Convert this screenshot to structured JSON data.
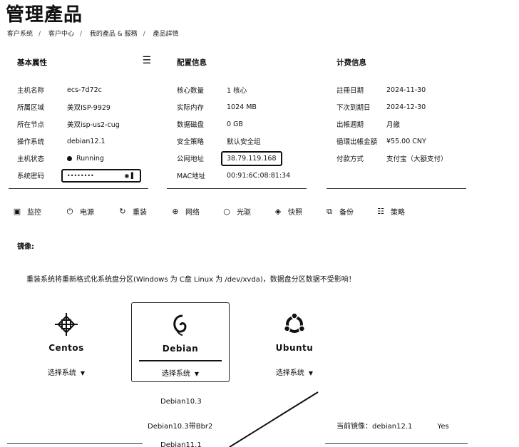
{
  "page": {
    "title": "管理產品"
  },
  "breadcrumb": [
    "客户系统",
    "客户中心",
    "我的產品 & 服務",
    "產品詳情"
  ],
  "basic": {
    "title": "基本属性",
    "rows": [
      {
        "label": "主机名称",
        "value": "ecs-7d72c"
      },
      {
        "label": "所属区域",
        "value": "美双ISP-9929"
      },
      {
        "label": "所在节点",
        "value": "美双isp-us2-cug"
      },
      {
        "label": "操作系统",
        "value": "debian12.1"
      },
      {
        "label": "主机状态",
        "value": "Running"
      },
      {
        "label": "系统密码",
        "value": "••••••••"
      }
    ]
  },
  "config": {
    "title": "配置信息",
    "rows": [
      {
        "label": "核心数量",
        "value": "1 核心"
      },
      {
        "label": "实际内存",
        "value": "1024 MB"
      },
      {
        "label": "数据磁盘",
        "value": "0 GB"
      },
      {
        "label": "安全策略",
        "value": "默认安全组"
      },
      {
        "label": "公网地址",
        "value": "38.79.119.168"
      },
      {
        "label": "MAC地址",
        "value": "00:91:6C:08:81:34"
      }
    ]
  },
  "billing": {
    "title": "计费信息",
    "rows": [
      {
        "label": "註冊日期",
        "value": "2024-11-30"
      },
      {
        "label": "下次到期日",
        "value": "2024-12-30"
      },
      {
        "label": "出帳週期",
        "value": "月繳"
      },
      {
        "label": "循環出帳金額",
        "value": "¥55.00 CNY"
      },
      {
        "label": "付款方式",
        "value": "支付宝（大额支付）"
      }
    ]
  },
  "toolbar": [
    "监控",
    "电源",
    "重装",
    "网络",
    "光驱",
    "快照",
    "备份",
    "策略"
  ],
  "mirror": {
    "label": "镜像:",
    "notice": "重装系统将重新格式化系统盘分区(Windows 为 C盘 Linux 为 /dev/xvda)，数据盘分区数据不受影响！"
  },
  "os_cards": [
    {
      "name": "Centos",
      "select": "选择系统"
    },
    {
      "name": "Debian",
      "select": "选择系统"
    },
    {
      "name": "Ubuntu",
      "select": "选择系统"
    }
  ],
  "dropdown": [
    "Debian10.3",
    "Debian10.3带Bbr2",
    "Debian11.1"
  ],
  "current": {
    "label": "当前镜像：debian12.1",
    "confirm": "Yes"
  }
}
